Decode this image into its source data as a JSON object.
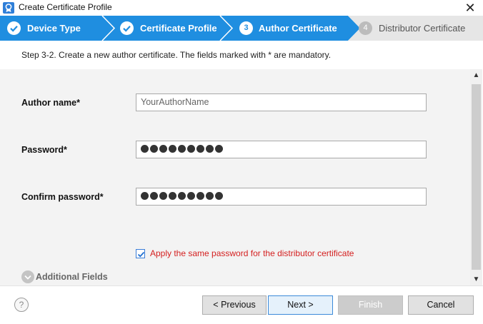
{
  "window": {
    "title": "Create Certificate Profile",
    "close_icon": "close-icon",
    "app_icon": "certificate-app-icon"
  },
  "steps": [
    {
      "label": "Device Type",
      "state": "done"
    },
    {
      "label": "Certificate Profile",
      "state": "done"
    },
    {
      "number": "3",
      "label": "Author Certificate",
      "state": "active"
    },
    {
      "number": "4",
      "label": "Distributor Certificate",
      "state": "pending"
    }
  ],
  "instruction": "Step 3-2. Create a new author certificate. The fields marked with * are mandatory.",
  "form": {
    "author_name_label": "Author name*",
    "author_name_placeholder": "YourAuthorName",
    "password_label": "Password*",
    "password_dot_count": 9,
    "confirm_password_label": "Confirm password*",
    "confirm_password_dot_count": 9,
    "apply_same_password_label": "Apply the same password for the distributor certificate",
    "apply_same_password_checked": true,
    "additional_fields_label": "Additional Fields"
  },
  "buttons": {
    "help": "?",
    "previous": "< Previous",
    "next": "Next >",
    "finish": "Finish",
    "cancel": "Cancel"
  },
  "colors": {
    "step_active": "#1f8ee0",
    "step_pending": "#e6e6e6",
    "mandatory_note": "#d42020"
  }
}
